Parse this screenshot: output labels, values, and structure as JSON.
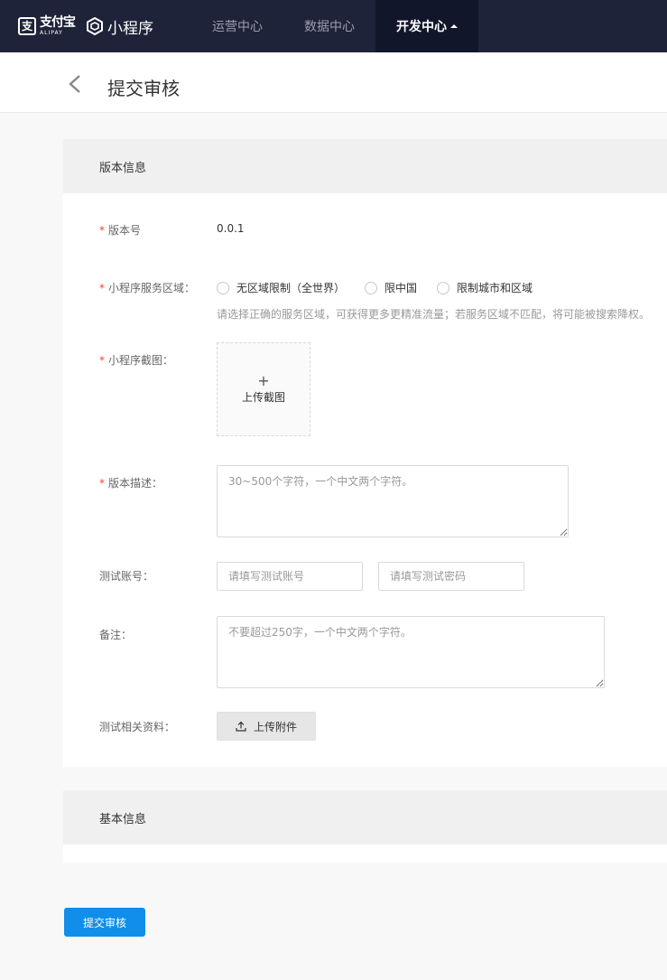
{
  "topbar": {
    "alipay_cn": "支付宝",
    "alipay_en": "ALIPAY",
    "product": "小程序",
    "nav": [
      {
        "label": "运营中心"
      },
      {
        "label": "数据中心"
      },
      {
        "label": "开发中心",
        "active": true
      }
    ]
  },
  "header": {
    "title": "提交审核"
  },
  "version_card": {
    "title": "版本信息",
    "version_label": "版本号",
    "version_value": "0.0.1",
    "region_label": "小程序服务区域：",
    "region_options": [
      "无区域限制（全世界）",
      "限中国",
      "限制城市和区域"
    ],
    "region_hint": "请选择正确的服务区域，可获得更多更精准流量；若服务区域不匹配，将可能被搜索降权。",
    "screenshot_label": "小程序截图：",
    "screenshot_upload": "上传截图",
    "desc_label": "版本描述：",
    "desc_placeholder": "30~500个字符，一个中文两个字符。",
    "test_account_label": "测试账号：",
    "test_account_placeholder": "请填写测试账号",
    "test_password_placeholder": "请填写测试密码",
    "remark_label": "备注：",
    "remark_placeholder": "不要超过250字，一个中文两个字符。",
    "attachment_label": "测试相关资料：",
    "attachment_button": "上传附件"
  },
  "basic_card": {
    "title": "基本信息"
  },
  "submit_button": "提交审核",
  "colors": {
    "topbar_bg": "#1f2339",
    "primary": "#108ee9",
    "required": "#f04134"
  }
}
